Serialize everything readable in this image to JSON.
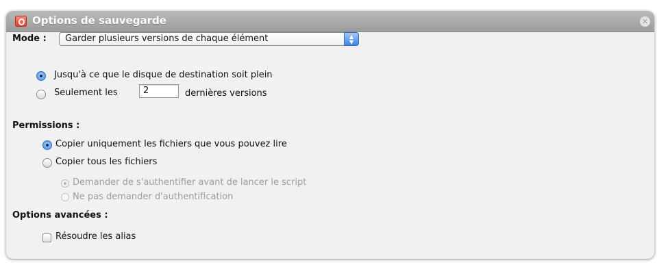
{
  "window": {
    "title": "Options de sauvegarde",
    "app_icon": "app-icon",
    "close_icon": "close-icon"
  },
  "mode": {
    "label": "Mode :",
    "selected": "Garder plusieurs versions de chaque élément",
    "options": [
      {
        "label": "Jusqu'à ce que le disque de destination soit plein",
        "selected": true
      },
      {
        "prefix": "Seulement les",
        "value": "2",
        "suffix": "dernières versions",
        "selected": false
      }
    ]
  },
  "permissions": {
    "heading": "Permissions :",
    "options": [
      {
        "label": "Copier uniquement les fichiers que vous pouvez lire",
        "selected": true
      },
      {
        "label": "Copier tous les fichiers",
        "selected": false
      }
    ],
    "sub_options": [
      {
        "label": "Demander de s'authentifier avant de lancer le script",
        "selected": true,
        "enabled": false
      },
      {
        "label": "Ne pas demander d'authentification",
        "selected": false,
        "enabled": false
      }
    ]
  },
  "advanced": {
    "heading": "Options avancées :",
    "resolve_alias_label": "Résoudre les alias",
    "resolve_alias_checked": false
  },
  "colors": {
    "titlebar": "#a9a9a9",
    "panel": "#f1f1f1",
    "accent": "#5d9cec",
    "disabled_text": "#9d9d9d"
  }
}
